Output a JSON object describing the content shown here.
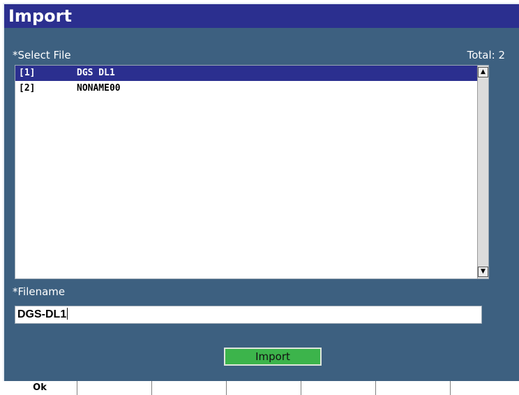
{
  "title": "Import",
  "select_file": {
    "label": "*Select File",
    "total_label": "Total:",
    "total_value": "2",
    "items": [
      {
        "index": "[1]",
        "name": "DGS DL1",
        "selected": true
      },
      {
        "index": "[2]",
        "name": "NONAME00",
        "selected": false
      }
    ]
  },
  "filename": {
    "label": "*Filename",
    "value": "DGS-DL1"
  },
  "import_button": {
    "label": "Import",
    "color": "#3cb44b"
  },
  "softkeys": [
    "Ok",
    "",
    "",
    "",
    "",
    "",
    ""
  ],
  "colors": {
    "title_bar": "#2b2f8f",
    "background": "#3d6080",
    "selection": "#2b2f8f"
  }
}
